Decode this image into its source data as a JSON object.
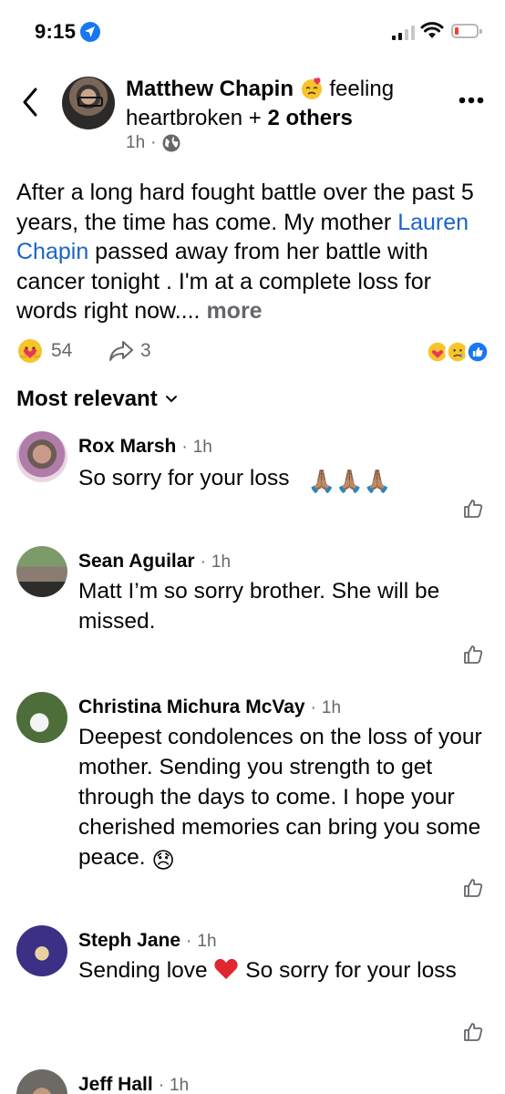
{
  "status_bar": {
    "time": "9:15"
  },
  "post": {
    "author": "Matthew Chapin",
    "feeling_text": "feeling",
    "feeling_word": "heartbroken",
    "with_prefix": " + ",
    "others": "2 others",
    "time": "1h",
    "meta_sep": "·",
    "body_part1": "After a long hard fought battle over the past 5 years, the time has come. My mother ",
    "mention": "Lauren Chapin",
    "body_part2": " passed away from her battle with cancer tonight . I'm at a complete loss for words right now.... ",
    "see_more": "more",
    "reaction_count": "54",
    "share_count": "3"
  },
  "sort_label": "Most relevant",
  "comments": [
    {
      "name": "Rox Marsh",
      "time": "1h",
      "text": "So sorry for your loss",
      "emoji": "🙏🏽🙏🏽🙏🏽"
    },
    {
      "name": "Sean Aguilar",
      "time": "1h",
      "text": "Matt I’m so sorry brother.   She will be missed."
    },
    {
      "name": "Christina Michura McVay",
      "time": "1h",
      "text": "Deepest condolences on the loss of your mother. Sending you strength to get through the days to come.  I hope your cherished memories can bring you some peace.",
      "emoji": "😞"
    },
    {
      "name": "Steph Jane",
      "time": "1h",
      "text_before": "Sending love",
      "text_after": " So sorry for your loss"
    },
    {
      "name": "Jeff Hall",
      "time": "1h"
    }
  ],
  "separator": "·",
  "colors": {
    "link": "#1b64c8",
    "muted": "#65676b",
    "location": "#1877f2",
    "battery_low": "#ff3b30"
  },
  "icons": [
    "back-chevron-icon",
    "globe-icon",
    "more-dots-icon",
    "care-reaction-icon",
    "share-arrow-icon",
    "like-thumb-icon",
    "chevron-down-icon",
    "location-arrow-icon",
    "signal-icon",
    "wifi-icon",
    "battery-icon"
  ]
}
